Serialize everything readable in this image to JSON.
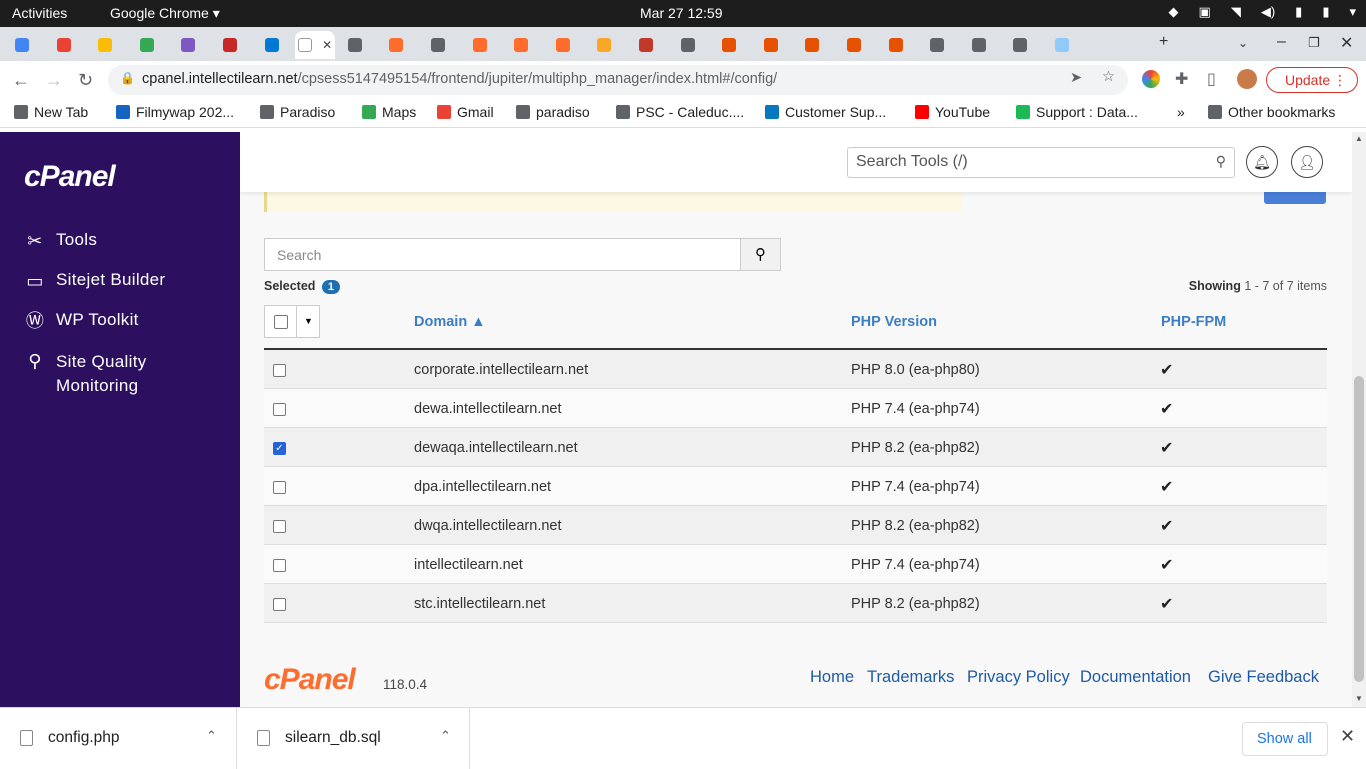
{
  "os_bar": {
    "activities": "Activities",
    "app": "Google Chrome ▾",
    "clock": "Mar 27  12:59"
  },
  "browser": {
    "url_host": "cpanel.intellectilearn.net",
    "url_path": "/cpsess5147495154/frontend/jupiter/multiphp_manager/index.html#/config/",
    "update_label": "Update",
    "tab_colors": [
      "#4285f4",
      "#ea4335",
      "#fbbc05",
      "#34a853",
      "#7e57c2",
      "#c62828",
      "#0078d4",
      "#ffffff",
      "#5f6368",
      "#ff6c2c",
      "#5f6368",
      "#ff6c2c",
      "#ff6c2c",
      "#ff6c2c",
      "#f9a825",
      "#c0392b",
      "#5f6368",
      "#e65100",
      "#e65100",
      "#e65100",
      "#e65100",
      "#e65100",
      "#5f6368",
      "#5f6368",
      "#5f6368",
      "#90caf9"
    ],
    "bookmarks": [
      {
        "label": "New Tab",
        "icon": "globe-icon",
        "color": "#5f6368"
      },
      {
        "label": "Filmywap 202...",
        "icon": "page-icon",
        "color": "#1565c0"
      },
      {
        "label": "Paradiso",
        "icon": "folder-icon",
        "color": "#5f6368"
      },
      {
        "label": "Maps",
        "icon": "maps-icon",
        "color": "#34a853"
      },
      {
        "label": "Gmail",
        "icon": "gmail-icon",
        "color": "#ea4335"
      },
      {
        "label": "paradiso",
        "icon": "folder-icon",
        "color": "#5f6368"
      },
      {
        "label": "PSC - Caleduc....",
        "icon": "globe-icon",
        "color": "#5f6368"
      },
      {
        "label": "Customer Sup...",
        "icon": "drupal-icon",
        "color": "#0678be"
      },
      {
        "label": "YouTube",
        "icon": "youtube-icon",
        "color": "#ff0000"
      },
      {
        "label": "Support : Data...",
        "icon": "support-icon",
        "color": "#1db954"
      }
    ],
    "other_bookmarks": "Other bookmarks"
  },
  "cpanel": {
    "logo": "cPanel",
    "nav": [
      {
        "label": "Tools",
        "icon": "tools-icon"
      },
      {
        "label": "Sitejet Builder",
        "icon": "sitejet-icon"
      },
      {
        "label": "WP Toolkit",
        "icon": "wordpress-icon"
      },
      {
        "label": "Site Quality",
        "label2": "Monitoring",
        "icon": "site-quality-icon"
      }
    ],
    "search_tools_placeholder": "Search Tools (/)",
    "table_search_placeholder": "Search",
    "selected_label": "Selected",
    "selected_count": "1",
    "showing_prefix": "Showing",
    "showing_range": "1 - 7 of 7 items",
    "columns": {
      "domain": "Domain ▲",
      "php": "PHP Version",
      "fpm": "PHP-FPM"
    },
    "rows": [
      {
        "domain": "corporate.intellectilearn.net",
        "php": "PHP 8.0 (ea-php80)",
        "fpm": "✔",
        "checked": false
      },
      {
        "domain": "dewa.intellectilearn.net",
        "php": "PHP 7.4 (ea-php74)",
        "fpm": "✔",
        "checked": false
      },
      {
        "domain": "dewaqa.intellectilearn.net",
        "php": "PHP 8.2 (ea-php82)",
        "fpm": "✔",
        "checked": true
      },
      {
        "domain": "dpa.intellectilearn.net",
        "php": "PHP 7.4 (ea-php74)",
        "fpm": "✔",
        "checked": false
      },
      {
        "domain": "dwqa.intellectilearn.net",
        "php": "PHP 8.2 (ea-php82)",
        "fpm": "✔",
        "checked": false
      },
      {
        "domain": "intellectilearn.net",
        "php": "PHP 7.4 (ea-php74)",
        "fpm": "✔",
        "checked": false
      },
      {
        "domain": "stc.intellectilearn.net",
        "php": "PHP 8.2 (ea-php82)",
        "fpm": "✔",
        "checked": false
      }
    ],
    "footer_logo": "cPanel",
    "version": "118.0.4",
    "footer_links": [
      "Home",
      "Trademarks",
      "Privacy Policy",
      "Documentation",
      "Give Feedback"
    ]
  },
  "downloads": {
    "files": [
      "config.php",
      "silearn_db.sql"
    ],
    "show_all": "Show all"
  },
  "colors": {
    "sidebar": "#2d0f5f",
    "accent": "#ff6c2c",
    "link": "#3b7ec4",
    "checkbox": "#2563d6"
  }
}
